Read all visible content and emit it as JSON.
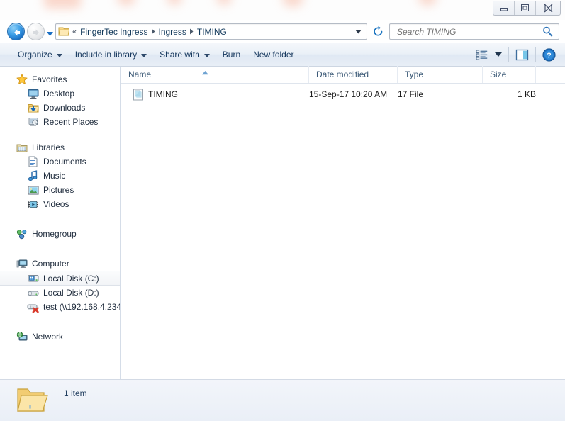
{
  "window": {
    "controls": {
      "minimize": "Minimize",
      "restore": "Restore Down",
      "close": "Close"
    }
  },
  "nav": {
    "back_tooltip": "Back",
    "forward_tooltip": "Forward",
    "recent_tooltip": "Recent pages",
    "refresh_tooltip": "Refresh",
    "address": {
      "overflow_chevron": "«",
      "crumbs": [
        "FingerTec Ingress",
        "Ingress",
        "TIMING"
      ],
      "separator": "▸"
    },
    "search": {
      "placeholder": "Search TIMING",
      "value": ""
    }
  },
  "toolbar": {
    "items": [
      {
        "label": "Organize",
        "has_caret": true
      },
      {
        "label": "Include in library",
        "has_caret": true
      },
      {
        "label": "Share with",
        "has_caret": true
      },
      {
        "label": "Burn",
        "has_caret": false
      },
      {
        "label": "New folder",
        "has_caret": false
      }
    ],
    "view_tooltip": "Change your view",
    "preview_tooltip": "Show the preview pane",
    "help_tooltip": "Get help"
  },
  "sidebar": {
    "groups": [
      {
        "header": {
          "label": "Favorites",
          "icon": "star-icon"
        },
        "items": [
          {
            "label": "Desktop",
            "icon": "desktop-icon"
          },
          {
            "label": "Downloads",
            "icon": "downloads-icon"
          },
          {
            "label": "Recent Places",
            "icon": "recent-places-icon"
          }
        ]
      },
      {
        "header": {
          "label": "Libraries",
          "icon": "libraries-icon"
        },
        "items": [
          {
            "label": "Documents",
            "icon": "documents-icon"
          },
          {
            "label": "Music",
            "icon": "music-icon"
          },
          {
            "label": "Pictures",
            "icon": "pictures-icon"
          },
          {
            "label": "Videos",
            "icon": "videos-icon"
          }
        ]
      },
      {
        "header": {
          "label": "Homegroup",
          "icon": "homegroup-icon"
        },
        "items": []
      },
      {
        "header": {
          "label": "Computer",
          "icon": "computer-icon"
        },
        "items": [
          {
            "label": "Local Disk (C:)",
            "icon": "hard-disk-system-icon",
            "selected": true
          },
          {
            "label": "Local Disk (D:)",
            "icon": "hard-disk-icon",
            "selected": false
          },
          {
            "label": "test (\\\\192.168.4.234",
            "icon": "network-drive-disconnected-icon",
            "selected": false
          }
        ]
      },
      {
        "header": {
          "label": "Network",
          "icon": "network-icon"
        },
        "items": []
      }
    ]
  },
  "filelist": {
    "columns": [
      {
        "label": "Name",
        "sorted": true,
        "sort_direction": "ascending"
      },
      {
        "label": "Date modified",
        "sorted": false
      },
      {
        "label": "Type",
        "sorted": false
      },
      {
        "label": "Size",
        "sorted": false
      }
    ],
    "rows": [
      {
        "icon": "generic-file-icon",
        "name": "TIMING",
        "date_modified": "15-Sep-17 10:20 AM",
        "type": "17 File",
        "size": "1 KB"
      }
    ]
  },
  "statusbar": {
    "icon": "open-folder-icon",
    "text": "1 item"
  },
  "colors": {
    "accent_blue": "#1a6fc4",
    "header_text": "#3c5a77",
    "crumb_text": "#12395b",
    "toolbar_text": "#16385e",
    "folder_yellow": "#fcd88b",
    "status_bg": "#eff3f9"
  }
}
